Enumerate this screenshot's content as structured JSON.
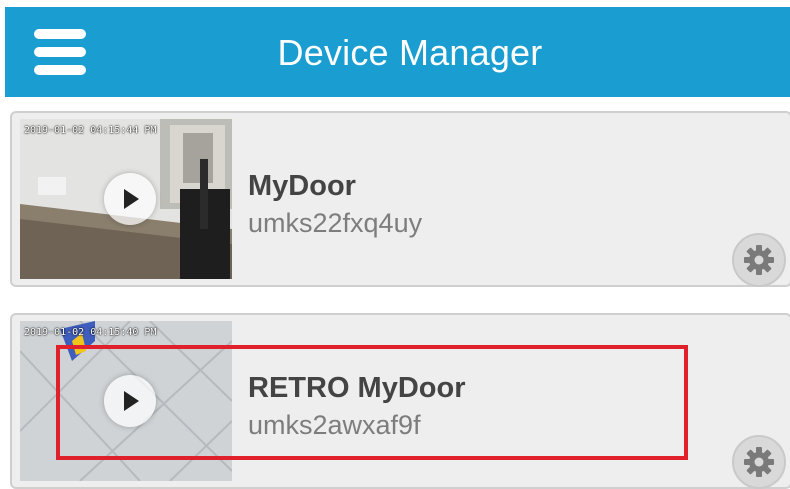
{
  "app_bar": {
    "title": "Device Manager",
    "menu_icon": "hamburger-menu-icon",
    "background_color": "#1a9ed1"
  },
  "devices": [
    {
      "name": "MyDoor",
      "id": "umks22fxq4uy",
      "thumbnail_timestamp": "2019-01-02 04:15:44 PM",
      "play_icon": "play-icon",
      "settings_icon": "gear-icon"
    },
    {
      "name": "RETRO MyDoor",
      "id": "umks2awxaf9f",
      "thumbnail_timestamp": "2019-01-02 04:15:40 PM",
      "play_icon": "play-icon",
      "settings_icon": "gear-icon",
      "highlighted": true
    }
  ],
  "highlight_color": "#e0202a"
}
